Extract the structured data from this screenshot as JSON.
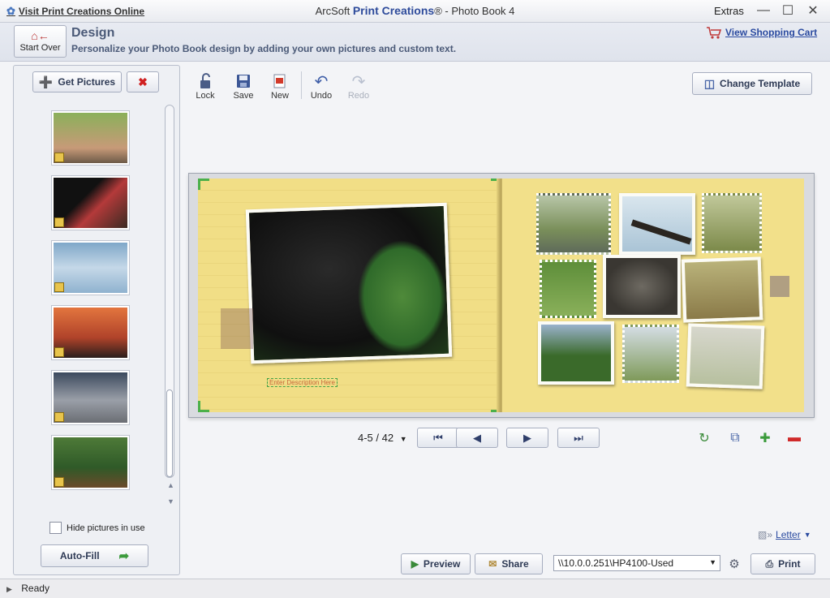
{
  "titlebar": {
    "visit_link": "Visit Print Creations Online",
    "brand_prefix": "ArcSoft ",
    "brand": "Print Creations",
    "suffix": "® - Photo Book 4",
    "extras": "Extras"
  },
  "header": {
    "start_over": "Start Over",
    "title": "Design",
    "subtitle": "Personalize your Photo Book design by adding your own pictures and custom text.",
    "cart": "View Shopping Cart"
  },
  "left_panel": {
    "get_pictures": "Get Pictures",
    "hide_in_use": "Hide pictures in use",
    "auto_fill": "Auto-Fill"
  },
  "toolbar": {
    "lock": "Lock",
    "save": "Save",
    "new": "New",
    "undo": "Undo",
    "redo": "Redo",
    "change_template": "Change Template"
  },
  "spread": {
    "description_placeholder": "Enter Description Here"
  },
  "nav": {
    "page_indicator": "4-5 / 42",
    "first": "⏮",
    "prev": "◀",
    "next": "▶",
    "last": "⏭"
  },
  "bottom": {
    "paper_size": "Letter",
    "preview": "Preview",
    "share": "Share",
    "printer": "\\\\10.0.0.251\\HP4100-Used",
    "print": "Print"
  },
  "status": {
    "text": "Ready"
  },
  "colors": {
    "accent": "#2e4b9b",
    "page_left": "#f1de86",
    "page_right": "#f2e08a",
    "guide_green": "#4bb04a"
  }
}
